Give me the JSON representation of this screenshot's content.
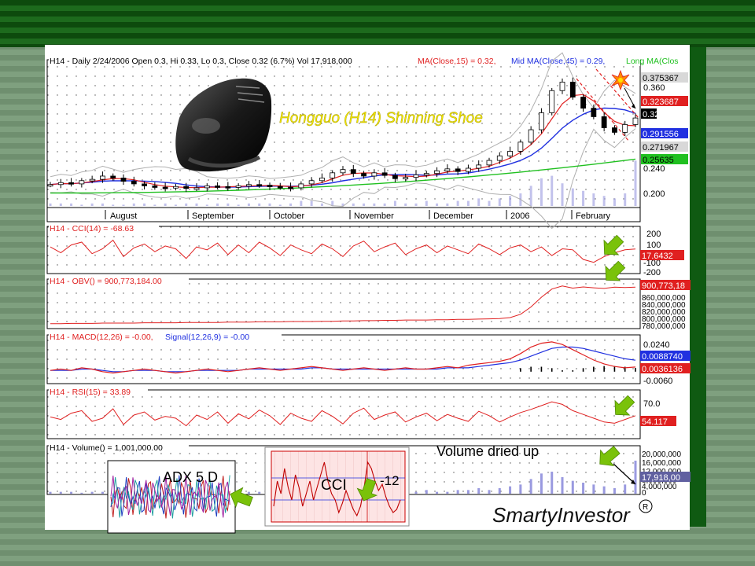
{
  "colors": {
    "background_dark": "#0d4a0d",
    "background_light": "#7fa07f",
    "candle_fill": "#000000",
    "ma15": "#e02020",
    "ma45": "#2030e0",
    "ma_long": "#20c020",
    "bollinger": "#b0b0b0",
    "volume_bar": "#9a9ae0",
    "arrow_green": "#7ac20a",
    "badge_red": "#e02020",
    "badge_blue": "#2030e0",
    "badge_green": "#20c020",
    "badge_gray": "#d8d8d8"
  },
  "title": "Hongguo (H14)  Shinning Shoe",
  "brand": "SmartyInvestor",
  "brand_mark": "R",
  "annotations": {
    "volume_note": "Volume dried up",
    "adx_label": "ADX 5 D",
    "cci_label": "CCI",
    "cci_value": "-12"
  },
  "icons": [
    "shoe-image",
    "starburst-icon",
    "green-arrow-icon"
  ],
  "chart_data": [
    {
      "type": "candlestick",
      "header": {
        "main": "H14 - Daily 2/24/2006 Open 0.3, Hi 0.33, Lo 0.3, Close 0.32 (6.7%) Vol 17,918,000",
        "ma15": "MA(Close,15) = 0.32,",
        "ma45": "Mid MA(Close,45) = 0.29,",
        "ma_long": "Long MA(Clos"
      },
      "months": [
        "August",
        "September",
        "October",
        "November",
        "December",
        "2006",
        "February"
      ],
      "y_ticks": [
        "0.360",
        "0.240",
        "0.200"
      ],
      "ylim": [
        0.19,
        0.39
      ],
      "badges": [
        {
          "text": "0.375367",
          "style": "gray",
          "value": 0.375367
        },
        {
          "text": "0.323687",
          "style": "red",
          "value": 0.323687
        },
        {
          "text": "0.32",
          "style": "black",
          "value": 0.32
        },
        {
          "text": "0.291556",
          "style": "blue",
          "value": 0.291556
        },
        {
          "text": "0.271967",
          "style": "gray",
          "value": 0.271967
        },
        {
          "text": "0.25635",
          "style": "green",
          "value": 0.25635
        }
      ],
      "price_path": [
        0.218,
        0.221,
        0.219,
        0.224,
        0.226,
        0.231,
        0.228,
        0.223,
        0.219,
        0.216,
        0.214,
        0.213,
        0.215,
        0.212,
        0.213,
        0.216,
        0.215,
        0.214,
        0.216,
        0.218,
        0.217,
        0.215,
        0.214,
        0.213,
        0.219,
        0.224,
        0.228,
        0.236,
        0.241,
        0.235,
        0.231,
        0.236,
        0.232,
        0.227,
        0.229,
        0.233,
        0.235,
        0.239,
        0.242,
        0.238,
        0.243,
        0.248,
        0.255,
        0.262,
        0.269,
        0.283,
        0.302,
        0.328,
        0.362,
        0.375,
        0.352,
        0.335,
        0.322,
        0.305,
        0.298,
        0.31,
        0.32
      ]
    },
    {
      "type": "line",
      "header": "H14 - CCI(14) = -68.63",
      "y_ticks": [
        "200",
        "100",
        "-100",
        "-200"
      ],
      "ylim": [
        -220,
        220
      ],
      "badge": "17.6432",
      "values": [
        40,
        -20,
        60,
        90,
        -30,
        20,
        110,
        -60,
        30,
        70,
        -10,
        50,
        20,
        -80,
        40,
        10,
        80,
        -40,
        60,
        -20,
        90,
        30,
        -50,
        60,
        10,
        -30,
        70,
        20,
        -60,
        50,
        100,
        -10,
        40,
        80,
        -40,
        20,
        60,
        -20,
        50,
        10,
        -30,
        70,
        20,
        -40,
        30,
        60,
        -10,
        40,
        -50,
        20,
        10,
        -90,
        -120,
        -60,
        -20,
        10,
        17.6
      ]
    },
    {
      "type": "line",
      "header": "H14 - OBV() = 900,773,184.00",
      "y_ticks": [
        "860,000,000",
        "840,000,000",
        "820,000,000",
        "800,000,000",
        "780,000,000"
      ],
      "badge": "900,773,18",
      "ylim": [
        770,
        920
      ],
      "values": [
        781,
        781,
        782,
        782,
        782,
        783,
        783,
        783,
        783,
        784,
        784,
        784,
        784,
        785,
        785,
        785,
        785,
        786,
        786,
        786,
        787,
        787,
        787,
        788,
        788,
        788,
        789,
        789,
        790,
        790,
        791,
        791,
        792,
        792,
        793,
        793,
        793,
        794,
        794,
        795,
        795,
        796,
        797,
        798,
        801,
        812,
        836,
        868,
        895,
        905,
        898,
        902,
        899,
        897,
        901,
        900,
        901
      ]
    },
    {
      "type": "line",
      "header_macd": "H14 - MACD(12,26) = -0.00,",
      "header_signal": "Signal(12,26,9) = -0.00",
      "y_ticks": [
        "0.0240",
        "-0.0060"
      ],
      "badges": [
        "0.0088740",
        "0.0036136"
      ],
      "ylim": [
        -0.008,
        0.026
      ],
      "macd": [
        0.001,
        0.002,
        0.001,
        0.003,
        0.002,
        0.0,
        -0.001,
        0.0,
        0.001,
        0.002,
        0.001,
        0.0,
        -0.001,
        0.0,
        0.001,
        0.002,
        0.001,
        0.0,
        0.001,
        0.002,
        0.003,
        0.002,
        0.001,
        0.002,
        0.003,
        0.004,
        0.003,
        0.002,
        0.001,
        0.002,
        0.003,
        0.002,
        0.001,
        0.002,
        0.003,
        0.002,
        0.002,
        0.003,
        0.004,
        0.003,
        0.005,
        0.006,
        0.007,
        0.008,
        0.01,
        0.014,
        0.019,
        0.022,
        0.023,
        0.021,
        0.017,
        0.013,
        0.009,
        0.006,
        0.004,
        0.003,
        0.0036
      ],
      "signal": [
        0.001,
        0.001,
        0.001,
        0.002,
        0.002,
        0.001,
        0.0,
        0.0,
        0.001,
        0.001,
        0.001,
        0.0,
        0.0,
        0.0,
        0.001,
        0.001,
        0.001,
        0.001,
        0.001,
        0.002,
        0.002,
        0.002,
        0.002,
        0.002,
        0.002,
        0.003,
        0.003,
        0.002,
        0.002,
        0.002,
        0.002,
        0.002,
        0.002,
        0.002,
        0.002,
        0.002,
        0.002,
        0.002,
        0.003,
        0.003,
        0.003,
        0.004,
        0.005,
        0.006,
        0.007,
        0.009,
        0.012,
        0.015,
        0.018,
        0.019,
        0.019,
        0.018,
        0.016,
        0.014,
        0.012,
        0.01,
        0.0089
      ]
    },
    {
      "type": "line",
      "header": "H14 - RSI(15) = 33.89",
      "y_ticks": [
        "70.0"
      ],
      "badge": "54.117",
      "ylim": [
        20,
        90
      ],
      "values": [
        52,
        48,
        58,
        62,
        45,
        50,
        65,
        40,
        55,
        60,
        47,
        53,
        50,
        38,
        55,
        48,
        60,
        42,
        57,
        49,
        63,
        54,
        40,
        58,
        50,
        45,
        62,
        53,
        41,
        58,
        66,
        48,
        55,
        60,
        44,
        52,
        58,
        46,
        56,
        50,
        45,
        61,
        54,
        44,
        52,
        59,
        64,
        70,
        76,
        72,
        62,
        56,
        50,
        44,
        42,
        48,
        54
      ]
    },
    {
      "type": "bar",
      "header": "H14 - Volume() = 1,001,000.00",
      "y_ticks": [
        "20,000,000",
        "16,000,000",
        "12,000,000",
        "8,000,000",
        "4,000,000",
        "0"
      ],
      "badge": "17,918,00",
      "ylim": [
        0,
        24
      ],
      "values": [
        1,
        1,
        1,
        0.5,
        1,
        1,
        0.5,
        0.5,
        1,
        1,
        0.5,
        1,
        0.5,
        1,
        1,
        0.5,
        1,
        1,
        0.5,
        1,
        1,
        1,
        0.5,
        1,
        2,
        2,
        1,
        2,
        1,
        1,
        1,
        1,
        1,
        2,
        1,
        1,
        2,
        1,
        1,
        2,
        2,
        3,
        2,
        3,
        4,
        5,
        8,
        11,
        12,
        9,
        7,
        6,
        5,
        4,
        3,
        5,
        18
      ]
    }
  ]
}
